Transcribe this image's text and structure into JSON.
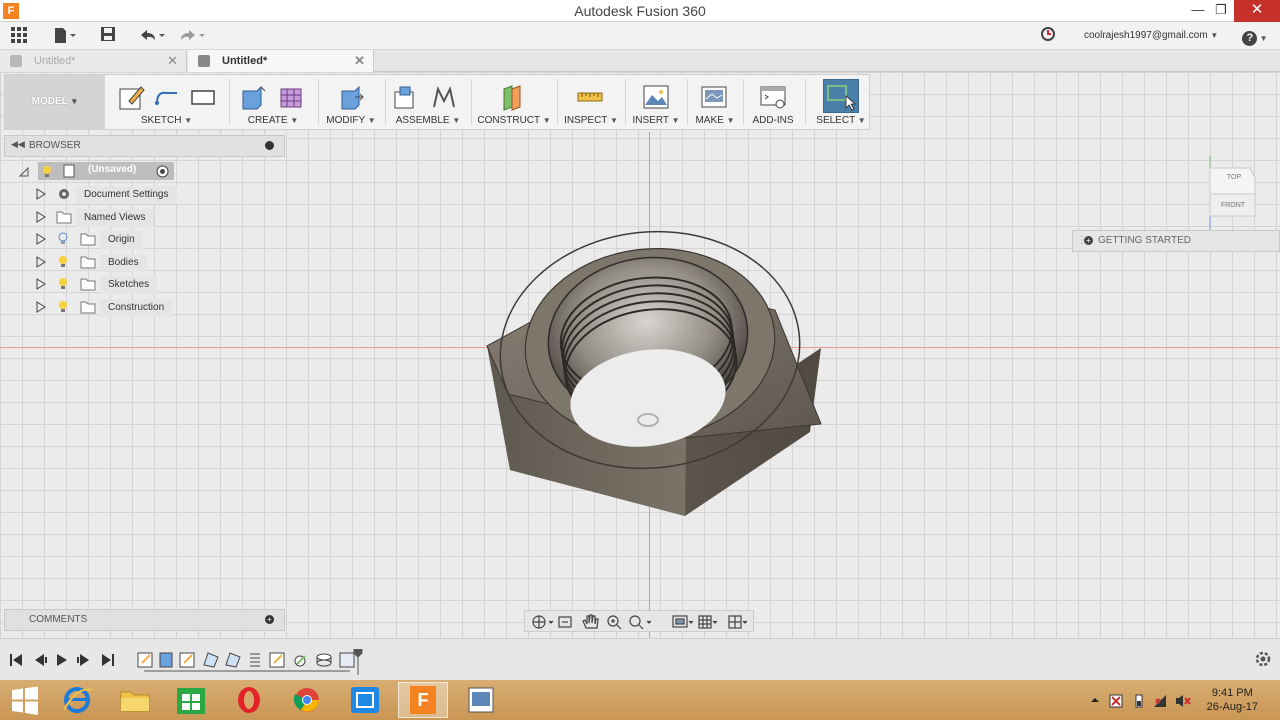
{
  "window": {
    "title": "Autodesk Fusion 360",
    "app_icon": "F"
  },
  "appbar": {
    "user_email": "coolrajesh1997@gmail.com",
    "help": "?"
  },
  "tabs": [
    {
      "label": "Untitled*",
      "active": false
    },
    {
      "label": "Untitled*",
      "active": true
    }
  ],
  "toolbar": {
    "workspace": "MODEL",
    "groups": [
      {
        "label": "SKETCH",
        "caret": true
      },
      {
        "label": "CREATE",
        "caret": true
      },
      {
        "label": "MODIFY",
        "caret": true
      },
      {
        "label": "ASSEMBLE",
        "caret": true
      },
      {
        "label": "CONSTRUCT",
        "caret": true
      },
      {
        "label": "INSPECT",
        "caret": true
      },
      {
        "label": "INSERT",
        "caret": true
      },
      {
        "label": "MAKE",
        "caret": true
      },
      {
        "label": "ADD-INS",
        "caret": false
      },
      {
        "label": "SELECT",
        "caret": true
      }
    ]
  },
  "browser": {
    "title": "BROWSER",
    "root": "(Unsaved)",
    "items": [
      "Document Settings",
      "Named Views",
      "Origin",
      "Bodies",
      "Sketches",
      "Construction"
    ]
  },
  "comments": {
    "title": "COMMENTS"
  },
  "getting_started": {
    "label": "GETTING STARTED"
  },
  "viewcube": {
    "top": "TOP",
    "front": "FRONT"
  },
  "taskbar": {
    "time": "9:41 PM",
    "date": "26-Aug-17"
  },
  "colors": {
    "accent": "#4a7fa8",
    "close": "#c7312b",
    "fusion_orange": "#f58220"
  }
}
